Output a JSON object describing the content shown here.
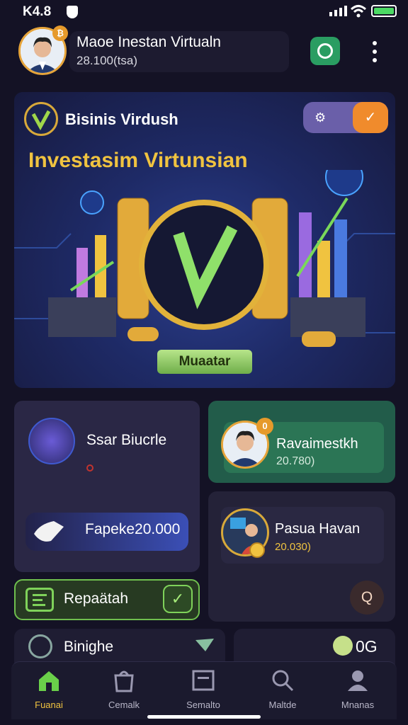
{
  "status_bar": {
    "time": "K4.8"
  },
  "header": {
    "title": "Maoe Inestan Virtualn",
    "subtitle": "28.100(tsa)",
    "badge": "₿"
  },
  "hero": {
    "brand": "Bisinis Virdush",
    "headline": "Investasim Virtunsian",
    "button_label": "Muaatar"
  },
  "cards": {
    "sb": {
      "title": "Ssar Biucrle",
      "fee": "Fapeke20.000"
    },
    "ra": {
      "title": "Ravaimestkh",
      "subtitle": "20.780)",
      "badge": "0"
    },
    "pd": {
      "title": "Pasua Havan",
      "subtitle": "20.030)",
      "help": "Q"
    },
    "rep": {
      "label": "Repaätah"
    },
    "bs": {
      "label": "Binighe"
    },
    "og": {
      "label": "0G"
    }
  },
  "nav": [
    {
      "label": "Fuanai",
      "icon": "home-icon"
    },
    {
      "label": "Cemalk",
      "icon": "bag-icon"
    },
    {
      "label": "Semalto",
      "icon": "chart-icon"
    },
    {
      "label": "Maltde",
      "icon": "search-icon"
    },
    {
      "label": "Mnanas",
      "icon": "profile-icon"
    }
  ],
  "colors": {
    "accent": "#f0c340",
    "green": "#2a9d62",
    "background": "#141225"
  }
}
